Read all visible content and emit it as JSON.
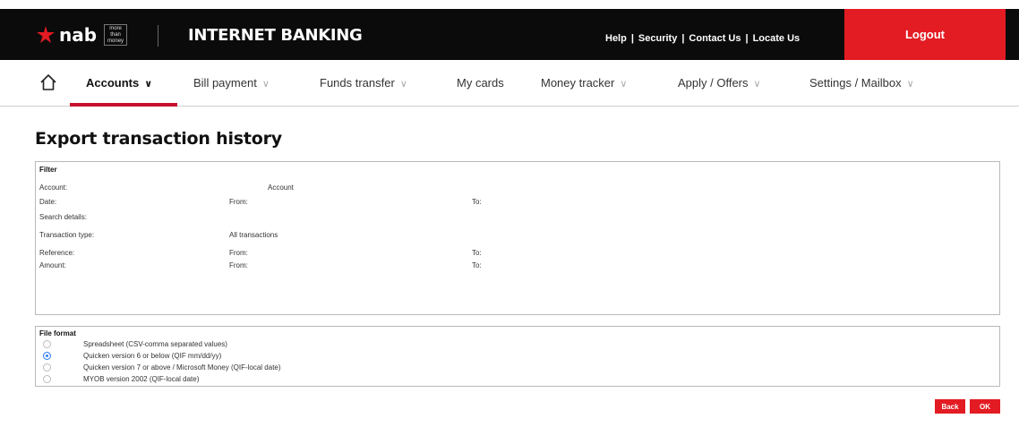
{
  "header": {
    "logo_text": "nab",
    "logo_tagline": [
      "more",
      "than",
      "money"
    ],
    "title": "INTERNET BANKING",
    "links": [
      "Help",
      "Security",
      "Contact Us",
      "Locate Us"
    ],
    "logout_label": "Logout"
  },
  "nav": {
    "items": [
      {
        "label": "Accounts",
        "chevron": "chevron-down-icon",
        "active": true
      },
      {
        "label": "Bill payment",
        "chevron": "chevron-down-icon"
      },
      {
        "label": "Funds transfer",
        "chevron": "chevron-down-icon"
      },
      {
        "label": "My cards"
      },
      {
        "label": "Money tracker",
        "chevron": "chevron-down-icon"
      },
      {
        "label": "Apply / Offers",
        "chevron": "chevron-down-icon"
      },
      {
        "label": "Settings / Mailbox",
        "chevron": "chevron-down-icon"
      }
    ]
  },
  "page": {
    "title": "Export transaction history"
  },
  "filter": {
    "heading": "Filter",
    "account_label": "Account:",
    "account_value": "Account",
    "date_label": "Date:",
    "date_from": "From:",
    "date_to": "To:",
    "search_label": "Search details:",
    "type_label": "Transaction type:",
    "type_value": "All transactions",
    "reference_label": "Reference:",
    "reference_from": "From:",
    "reference_to": "To:",
    "amount_label": "Amount:",
    "amount_from": "From:",
    "amount_to": "To:"
  },
  "file_format": {
    "heading": "File format",
    "options": [
      {
        "label": "Spreadsheet (CSV-comma separated values)",
        "selected": false
      },
      {
        "label": "Quicken version 6 or below (QIF mm/dd/yy)",
        "selected": true
      },
      {
        "label": "Quicken version 7 or above / Microsoft Money (QIF-local date)",
        "selected": false
      },
      {
        "label": "MYOB version 2002 (QIF-local date)",
        "selected": false
      }
    ]
  },
  "actions": {
    "back_label": "Back",
    "ok_label": "OK"
  },
  "colors": {
    "brand_red": "#e31b23",
    "header_black": "#0b0b0b",
    "radio_blue": "#2f7ef0"
  }
}
